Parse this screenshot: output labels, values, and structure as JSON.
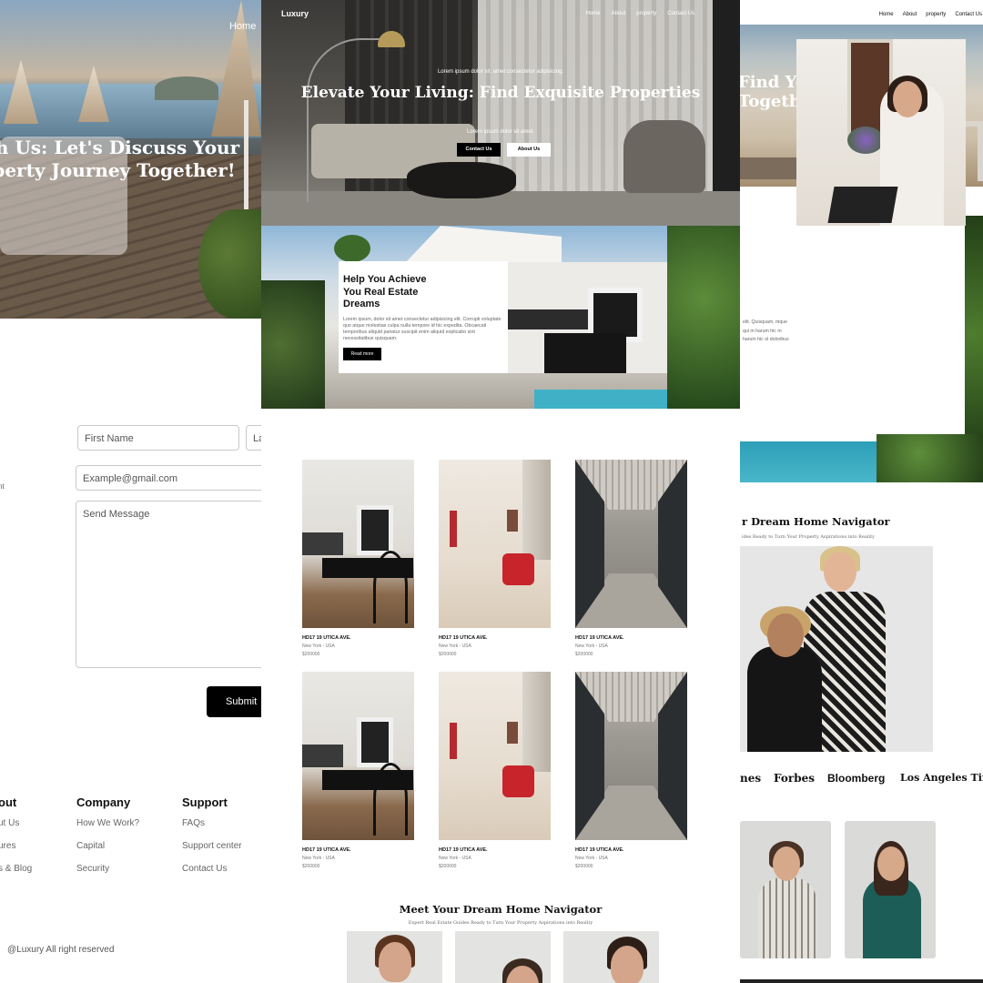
{
  "left_panel": {
    "nav_home": "Home",
    "hero_title": "ith Us: Let's Discuss Your operty Journey Together!",
    "form": {
      "first_name_placeholder": "First Name",
      "last_name_placeholder": "La",
      "email_placeholder": "Example@gmail.com",
      "message_placeholder": "Send Message",
      "side_label": "nt",
      "submit_label": "Submit"
    },
    "footer": {
      "col_about": {
        "heading": "out",
        "items": [
          "ut Us",
          "ures",
          "s & Blog"
        ]
      },
      "col_company": {
        "heading": "Company",
        "items": [
          "How We Work?",
          "Capital",
          "Security"
        ]
      },
      "col_support": {
        "heading": "Support",
        "items": [
          "FAQs",
          "Support center",
          "Contact Us"
        ]
      },
      "copyright": "@Luxury All right reserved"
    }
  },
  "center_panel": {
    "brand": "Luxury",
    "nav": [
      "Home",
      "About",
      "property",
      "Contact Us"
    ],
    "hero": {
      "kicker": "Lorem ipsum dolor sit, amet consectetur adipisicing.",
      "title": "Elevate Your Living: Find Exquisite Properties",
      "subtitle": "Lorem ipsum dolor sit amet.",
      "btn_contact": "Contact Us",
      "btn_about": "About Us"
    },
    "about_card": {
      "title": "Help You Achieve You Real Estate Dreams",
      "body": "Lorem ipsum, dolor sit amet consectetur adipisicing elit. Corrupti voluptate quo atque molestias culpa nulla tempore id hic expedita. Obcaecati temporibus aliquid pariatur suscipit enim aliquid explicabo sint necessitatibus quisquam.",
      "button": "Read more"
    },
    "properties": [
      {
        "title": "HD17 19 UTICA AVE.",
        "location": "New York - USA",
        "price": "$200000"
      },
      {
        "title": "HD17 19 UTICA AVE.",
        "location": "New York - USA",
        "price": "$200000"
      },
      {
        "title": "HD17 19 UTICA AVE.",
        "location": "New York - USA",
        "price": "$200000"
      },
      {
        "title": "HD17 19 UTICA AVE.",
        "location": "New York - USA",
        "price": "$200000"
      },
      {
        "title": "HD17 19 UTICA AVE.",
        "location": "New York - USA",
        "price": "$200000"
      },
      {
        "title": "HD17 19 UTICA AVE.",
        "location": "New York - USA",
        "price": "$200000"
      }
    ],
    "team": {
      "title": "Meet Your Dream Home Navigator",
      "subtitle": "Expert Real Estate Guides Ready to Turn Your Property Aspirations into Reality"
    }
  },
  "right_panel": {
    "nav": [
      "Home",
      "About",
      "property",
      "Contact Us"
    ],
    "hero_title": "Find Your Dream me Together",
    "about_text": "elit. Quisquam, mque qui m harum hic m harum hic st doloribus",
    "team": {
      "title": "r Dream Home Navigator",
      "subtitle": "ides Ready to Turn Your Property Aspirations into Reality"
    },
    "press": [
      "nes",
      "Forbes",
      "Bloomberg",
      "Los Angeles Times"
    ]
  },
  "colors": {
    "black": "#000000",
    "pool": "#3fb0c6",
    "accent_red_chair": "#c8242b"
  }
}
